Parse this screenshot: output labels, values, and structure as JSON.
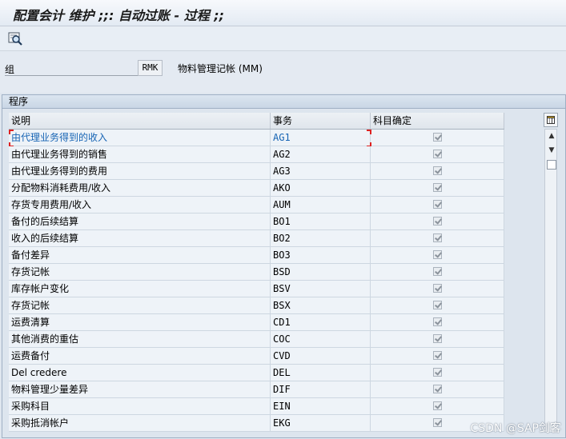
{
  "window": {
    "title": "配置会计 维护 ;;: 自动过账 - 过程 ;;"
  },
  "toolbar": {
    "icons": [
      "find-icon"
    ]
  },
  "form": {
    "group_label": "组",
    "group_value": "RMK",
    "group_desc": "物料管理记帐 (MM)"
  },
  "section": {
    "title": "程序"
  },
  "table": {
    "columns": [
      "说明",
      "事务",
      "科目确定"
    ],
    "rows": [
      {
        "desc": "由代理业务得到的收入",
        "code": "AG1",
        "checked": true
      },
      {
        "desc": "由代理业务得到的销售",
        "code": "AG2",
        "checked": true
      },
      {
        "desc": "由代理业务得到的费用",
        "code": "AG3",
        "checked": true
      },
      {
        "desc": "分配物料消耗费用/收入",
        "code": "AKO",
        "checked": true
      },
      {
        "desc": "存货专用费用/收入",
        "code": "AUM",
        "checked": true
      },
      {
        "desc": "备付的后续结算",
        "code": "BO1",
        "checked": true
      },
      {
        "desc": "收入的后续结算",
        "code": "BO2",
        "checked": true
      },
      {
        "desc": "备付差异",
        "code": "BO3",
        "checked": true
      },
      {
        "desc": "存货记帐",
        "code": "BSD",
        "checked": true
      },
      {
        "desc": "库存帐户变化",
        "code": "BSV",
        "checked": true
      },
      {
        "desc": "存货记帐",
        "code": "BSX",
        "checked": true
      },
      {
        "desc": "运费清算",
        "code": "CD1",
        "checked": true
      },
      {
        "desc": "其他消费的重估",
        "code": "COC",
        "checked": true
      },
      {
        "desc": "运费备付",
        "code": "CVD",
        "checked": true
      },
      {
        "desc": "Del credere",
        "code": "DEL",
        "checked": true
      },
      {
        "desc": "物料管理少量差异",
        "code": "DIF",
        "checked": true
      },
      {
        "desc": "采购科目",
        "code": "EIN",
        "checked": true
      },
      {
        "desc": "采购抵消帐户",
        "code": "EKG",
        "checked": true
      }
    ]
  },
  "watermark": "CSDN @SAP剑客"
}
